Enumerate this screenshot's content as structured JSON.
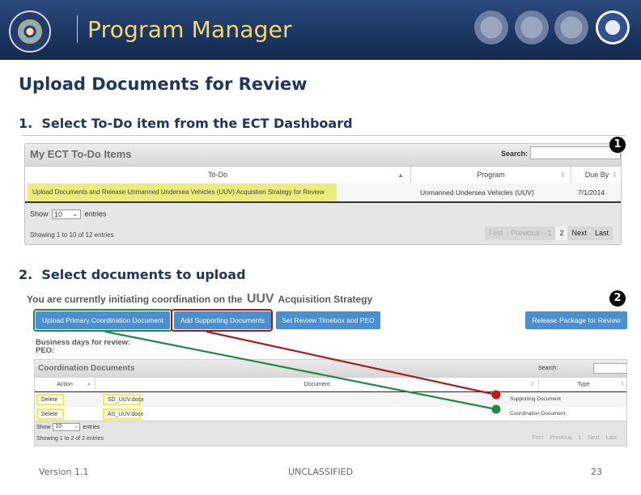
{
  "header": {
    "title": "Program Manager",
    "seals": [
      "dod-seal",
      "army-seal",
      "marine-corps-seal",
      "navy-seal",
      "air-force-seal"
    ]
  },
  "page_heading": "Upload Documents for Review",
  "step1": {
    "heading": "1.  Select To-Do item from the ECT Dashboard",
    "badge": "1",
    "panel": {
      "title": "My ECT To-Do Items",
      "search_label": "Search:",
      "search_value": "",
      "columns": [
        "To-Do",
        "Program",
        "Due By"
      ],
      "rows": [
        {
          "todo": "Upload Documents and Release Unmanned Undersea Vehicles (UUV) Acquistion Strategy for Review",
          "program": "Unmanned Undersea Vehicles (UUV)",
          "due_by": "7/1/2014"
        }
      ],
      "show_prefix": "Show",
      "page_length": "10",
      "show_suffix": "entries",
      "info": "Showing 1 to 10 of 12 entries",
      "pager": {
        "first": "First",
        "previous": "Previous",
        "pages": [
          "1",
          "2"
        ],
        "current_page": "2",
        "next": "Next",
        "last": "Last"
      }
    }
  },
  "step2": {
    "heading": "2.  Select documents to upload",
    "badge": "2",
    "coord_prefix": "You are currently initiating coordination on the",
    "coord_program": "UUV",
    "coord_suffix": "Acquisition Strategy",
    "buttons": {
      "upload_primary": "Upload Primary Coordination Document",
      "add_supporting": "Add Supporting Documents",
      "set_timebox": "Set Review Timebox and PEO",
      "release": "Release Package for Review"
    },
    "business_days_label": "Business days for review:",
    "peo_label": "PEO:",
    "highlight_colors": {
      "primary": "#1f8a47",
      "supporting": "#9a1b1f",
      "cell": "#f2f23a"
    },
    "table": {
      "title": "Coordination Documents",
      "search_label": "Search:",
      "search_value": "",
      "columns": [
        "Action",
        "Document",
        "Type"
      ],
      "rows": [
        {
          "action": "Delete",
          "document": "SD_UUV.docx",
          "type": "Supporting Document"
        },
        {
          "action": "Delete",
          "document": "AS_UUV.docx",
          "type": "Coordination Document"
        }
      ],
      "show_prefix": "Show",
      "page_length": "10",
      "show_suffix": "entries",
      "info": "Showing 1 to 2 of 2 entries",
      "pager": {
        "first": "First",
        "previous": "Previous",
        "pages": [
          "1"
        ],
        "next": "Next",
        "last": "Last"
      }
    }
  },
  "footer": {
    "version": "Version 1.1",
    "classification": "UNCLASSIFIED",
    "page_number": "23"
  }
}
